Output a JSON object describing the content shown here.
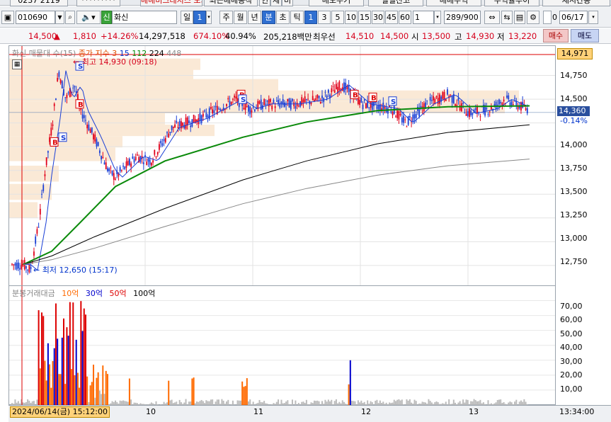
{
  "topbar": {
    "time_partial": "0237 2119",
    "masked_partial": "*********",
    "tab1": "매매비크레지스 도희",
    "tab2": "최근매매동작",
    "tab3": "인",
    "tab4": "재",
    "tab5": "미",
    "tab6": "매도주기",
    "tab7": "일별잔고",
    "tab8": "매매수익",
    "tab9": "수익률부이",
    "tab10": "재시간동"
  },
  "toolbar": {
    "code": "010690",
    "masked": "********",
    "badge": "신",
    "stock_name": "화신",
    "period_label": "일",
    "period_num": "1",
    "periods": [
      "주",
      "월",
      "년",
      "분",
      "초",
      "틱"
    ],
    "minute_buttons": [
      "1",
      "3",
      "5",
      "10",
      "15",
      "30",
      "45",
      "60"
    ],
    "selected_minute": "1",
    "count_value": "1",
    "range_value": "289/900",
    "date_checkbox_label": "0",
    "date_value": "06/17"
  },
  "quote": {
    "price": "14,500",
    "change_arrow": "▲",
    "change": "1,810",
    "change_pct": "+14.26%",
    "volume": "14,297,518",
    "volume_ratio": "674.10%",
    "turnover": "40.94%",
    "amount": "205,218백만",
    "best_label": "최우선",
    "best_ask": "14,510",
    "best_bid": "14,500",
    "open_label": "시",
    "open": "13,500",
    "high_label": "고",
    "high": "14,930",
    "low_label": "저",
    "low": "13,220",
    "buy_button": "매수",
    "sell_button": "매도"
  },
  "chart": {
    "legend_name": "화신",
    "legend_prefix": "매물대 수(15)",
    "legend_ma": "종가 지수 3",
    "legend_ma_values": [
      "15",
      "112",
      "224",
      "448"
    ],
    "high_annotation": "최고 14,930 (09:18)",
    "low_annotation": "최저 12,650 (15:17)",
    "current_price_tag": "14,971",
    "last_price_tag": "14,360",
    "last_change_tag": "-0.14%",
    "y_ticks": [
      "14,750",
      "14,500",
      "14,250",
      "14,000",
      "13,750",
      "13,500",
      "13,250",
      "13,000",
      "12,750"
    ]
  },
  "volume_chart": {
    "title": "분봉거래대금",
    "legend_items": [
      {
        "label": "10억",
        "color": "#ff6a00"
      },
      {
        "label": "30억",
        "color": "#0000cc"
      },
      {
        "label": "50억",
        "color": "#dd0000"
      },
      {
        "label": "100억",
        "color": "#000000"
      }
    ],
    "y_ticks": [
      "70,00",
      "60,00",
      "50,00",
      "40,00",
      "30,00",
      "20,00",
      "10,00"
    ]
  },
  "xaxis": {
    "cursor_label": "2024/06/14(금) 15:12:00",
    "day_labels": [
      "10",
      "11",
      "12",
      "13"
    ],
    "time_label": "13:34:00"
  },
  "chart_data": {
    "type": "candlestick",
    "ylim": [
      12600,
      15000
    ],
    "y_ticks": [
      12750,
      13000,
      13250,
      13500,
      13750,
      14000,
      14250,
      14500,
      14750
    ],
    "high": 14930,
    "low": 12650,
    "last": 14360,
    "volume_ylim": [
      0,
      75
    ],
    "volume_y_ticks": [
      10,
      20,
      30,
      40,
      50,
      60,
      70
    ]
  }
}
